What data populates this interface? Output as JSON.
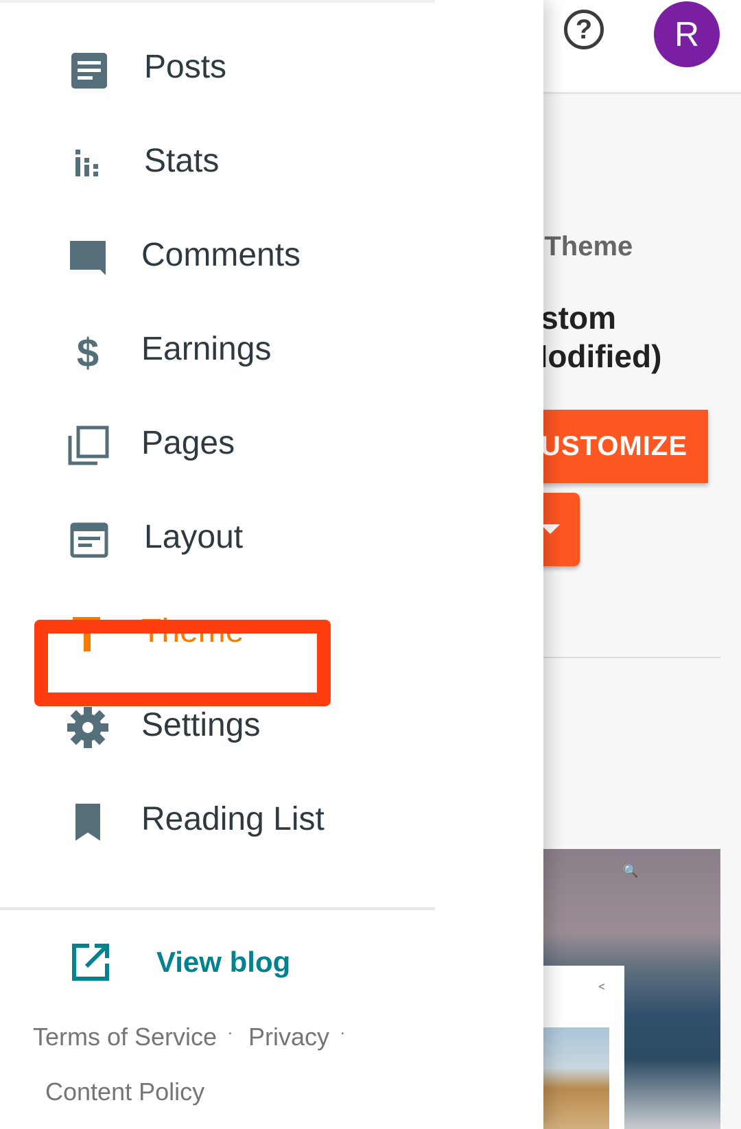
{
  "background_page": {
    "help_icon_glyph": "?",
    "avatar_initial": "R",
    "my_theme_label": "y Theme",
    "theme_name_line1": "ustom",
    "theme_name_line2": "Modified)",
    "customize_label": "CUSTOMIZE"
  },
  "drawer": {
    "items": [
      {
        "label": "Posts",
        "icon": "posts-icon"
      },
      {
        "label": "Stats",
        "icon": "stats-icon"
      },
      {
        "label": "Comments",
        "icon": "comments-icon"
      },
      {
        "label": "Earnings",
        "icon": "dollar-icon"
      },
      {
        "label": "Pages",
        "icon": "pages-icon"
      },
      {
        "label": "Layout",
        "icon": "layout-icon"
      },
      {
        "label": "Theme",
        "icon": "paint-roller-icon",
        "active": true
      },
      {
        "label": "Settings",
        "icon": "gear-icon"
      },
      {
        "label": "Reading List",
        "icon": "bookmark-icon"
      }
    ],
    "view_blog_label": "View blog",
    "footer": {
      "terms": "Terms of Service",
      "privacy": "Privacy",
      "content_policy": "Content Policy",
      "separator": "·"
    }
  },
  "colors": {
    "icon_gray": "#546e7a",
    "active_orange": "#f57c00",
    "highlight_red": "#ff3d0f",
    "customize_orange": "#ff5722",
    "link_teal": "#00838f",
    "avatar_purple": "#7b1fa2"
  }
}
